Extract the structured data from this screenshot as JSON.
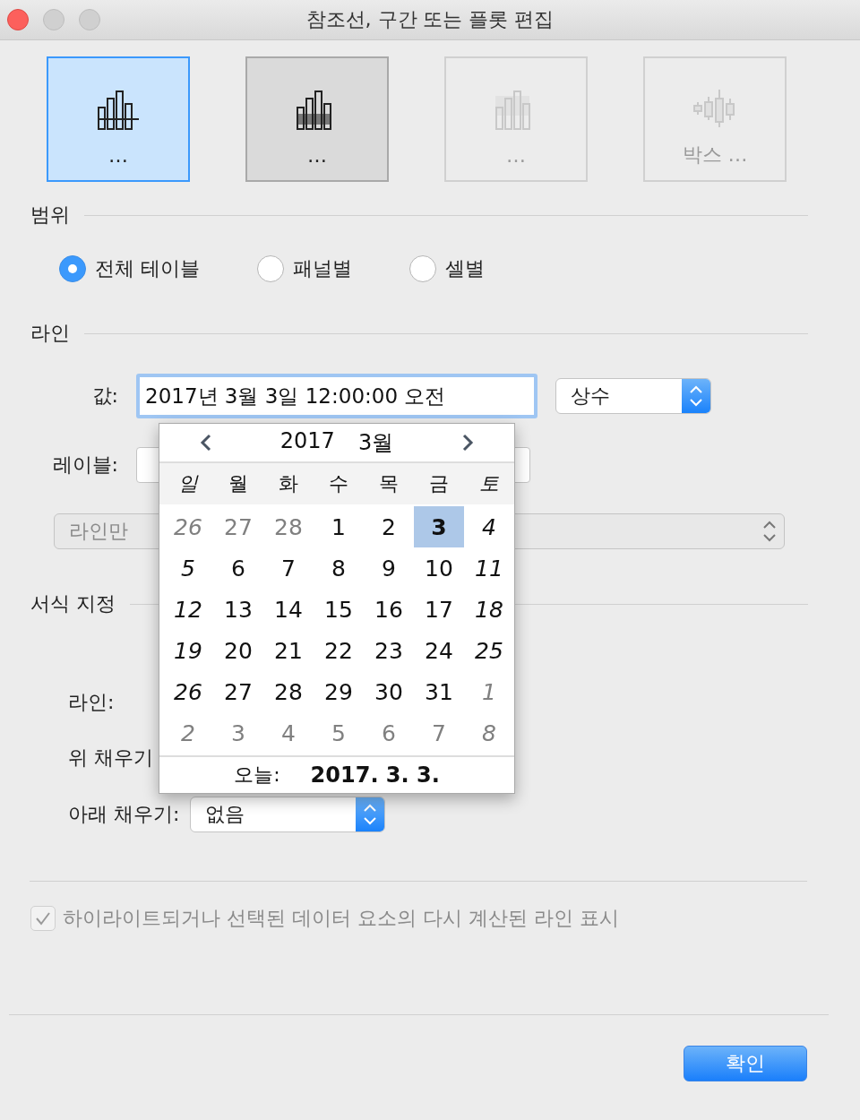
{
  "window": {
    "title": "참조선, 구간 또는 플롯 편집"
  },
  "line_types": [
    {
      "kind": "line",
      "label": "…",
      "selected": true,
      "pressed": false,
      "disabled": false
    },
    {
      "kind": "band",
      "label": "…",
      "selected": false,
      "pressed": true,
      "disabled": false
    },
    {
      "kind": "distribution",
      "label": "…",
      "selected": false,
      "pressed": false,
      "disabled": true
    },
    {
      "kind": "box",
      "label": "박스 …",
      "selected": false,
      "pressed": false,
      "disabled": true
    }
  ],
  "scope": {
    "label": "범위",
    "options": [
      {
        "label": "전체 테이블",
        "selected": true
      },
      {
        "label": "패널별",
        "selected": false
      },
      {
        "label": "셀별",
        "selected": false
      }
    ]
  },
  "line": {
    "label": "라인",
    "value_label": "값:",
    "value": "2017년 3월 3일 12:00:00 오전",
    "value_type": "상수",
    "label_label": "레이블:",
    "label_mode": {
      "value": "라인만",
      "disabled": true
    }
  },
  "calendar": {
    "year": "2017",
    "month": "3월",
    "weekdays": [
      "일",
      "월",
      "화",
      "수",
      "목",
      "금",
      "토"
    ],
    "weeks": [
      [
        {
          "day": "26",
          "outside": true,
          "selected": false
        },
        {
          "day": "27",
          "outside": true,
          "selected": false
        },
        {
          "day": "28",
          "outside": true,
          "selected": false
        },
        {
          "day": "1",
          "outside": false,
          "selected": false
        },
        {
          "day": "2",
          "outside": false,
          "selected": false
        },
        {
          "day": "3",
          "outside": false,
          "selected": true
        },
        {
          "day": "4",
          "outside": false,
          "selected": false
        }
      ],
      [
        {
          "day": "5",
          "outside": false,
          "selected": false
        },
        {
          "day": "6",
          "outside": false,
          "selected": false
        },
        {
          "day": "7",
          "outside": false,
          "selected": false
        },
        {
          "day": "8",
          "outside": false,
          "selected": false
        },
        {
          "day": "9",
          "outside": false,
          "selected": false
        },
        {
          "day": "10",
          "outside": false,
          "selected": false
        },
        {
          "day": "11",
          "outside": false,
          "selected": false
        }
      ],
      [
        {
          "day": "12",
          "outside": false,
          "selected": false
        },
        {
          "day": "13",
          "outside": false,
          "selected": false
        },
        {
          "day": "14",
          "outside": false,
          "selected": false
        },
        {
          "day": "15",
          "outside": false,
          "selected": false
        },
        {
          "day": "16",
          "outside": false,
          "selected": false
        },
        {
          "day": "17",
          "outside": false,
          "selected": false
        },
        {
          "day": "18",
          "outside": false,
          "selected": false
        }
      ],
      [
        {
          "day": "19",
          "outside": false,
          "selected": false
        },
        {
          "day": "20",
          "outside": false,
          "selected": false
        },
        {
          "day": "21",
          "outside": false,
          "selected": false
        },
        {
          "day": "22",
          "outside": false,
          "selected": false
        },
        {
          "day": "23",
          "outside": false,
          "selected": false
        },
        {
          "day": "24",
          "outside": false,
          "selected": false
        },
        {
          "day": "25",
          "outside": false,
          "selected": false
        }
      ],
      [
        {
          "day": "26",
          "outside": false,
          "selected": false
        },
        {
          "day": "27",
          "outside": false,
          "selected": false
        },
        {
          "day": "28",
          "outside": false,
          "selected": false
        },
        {
          "day": "29",
          "outside": false,
          "selected": false
        },
        {
          "day": "30",
          "outside": false,
          "selected": false
        },
        {
          "day": "31",
          "outside": false,
          "selected": false
        },
        {
          "day": "1",
          "outside": true,
          "selected": false
        }
      ],
      [
        {
          "day": "2",
          "outside": true,
          "selected": false
        },
        {
          "day": "3",
          "outside": true,
          "selected": false
        },
        {
          "day": "4",
          "outside": true,
          "selected": false
        },
        {
          "day": "5",
          "outside": true,
          "selected": false
        },
        {
          "day": "6",
          "outside": true,
          "selected": false
        },
        {
          "day": "7",
          "outside": true,
          "selected": false
        },
        {
          "day": "8",
          "outside": true,
          "selected": false
        }
      ]
    ],
    "today_label": "오늘:",
    "today": "2017. 3. 3."
  },
  "format": {
    "label": "서식 지정",
    "line_label": "라인:",
    "fill_above_label": "위 채우기",
    "fill_below_label": "아래 채우기:",
    "fill_below": "없음"
  },
  "recalc": {
    "label": "하이라이트되거나 선택된 데이터 요소의 다시 계산된 라인 표시",
    "checked": true,
    "disabled": true
  },
  "ok_button": "확인"
}
